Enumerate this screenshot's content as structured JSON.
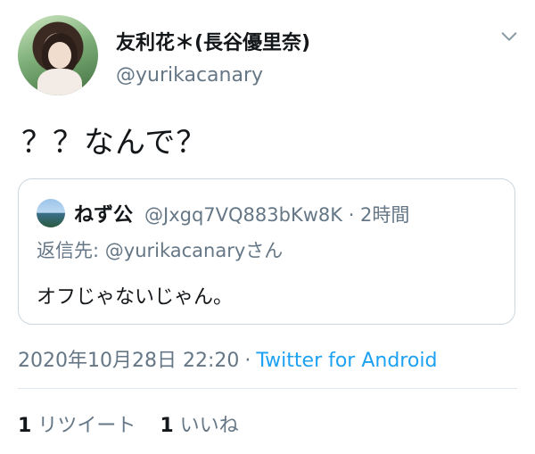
{
  "author": {
    "display_name": "友利花＊(長谷優里奈)",
    "handle": "@yurikacanary"
  },
  "tweet": {
    "text": "？？なんで？"
  },
  "quoted_tweet": {
    "author_name": "ねず公",
    "meta": "@Jxgq7VQ883bKw8K · 2時間",
    "reply_prefix": "返信先: ",
    "reply_to": "@yurikacanary",
    "reply_suffix": "さん",
    "text": "オフじゃないじゃん。"
  },
  "timestamp": {
    "datetime": "2020年10月28日 22:20",
    "separator": "·",
    "client": "Twitter for Android"
  },
  "stats": {
    "retweets_count": "1",
    "retweets_label": "リツイート",
    "likes_count": "1",
    "likes_label": "いいね"
  },
  "icons": {
    "menu": "chevron-down-icon"
  },
  "colors": {
    "link": "#1da1f2",
    "secondary_text": "#657786",
    "border": "#ccd6dd"
  }
}
